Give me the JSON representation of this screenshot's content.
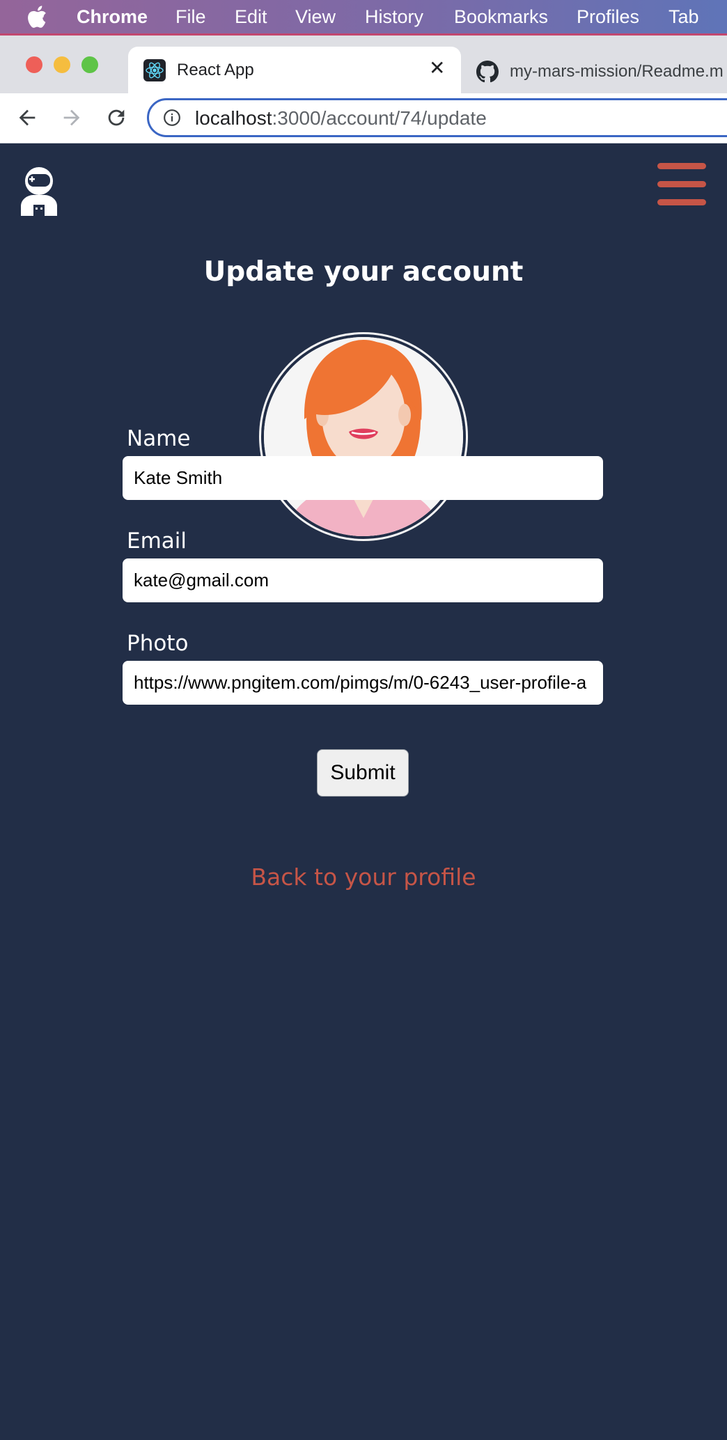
{
  "menubar": {
    "app_name": "Chrome",
    "items": [
      "File",
      "Edit",
      "View",
      "History",
      "Bookmarks",
      "Profiles",
      "Tab"
    ]
  },
  "browser": {
    "tabs": [
      {
        "title": "React App",
        "active": true,
        "icon": "react-icon"
      },
      {
        "title": "my-mars-mission/Readme.m",
        "active": false,
        "icon": "github-icon"
      }
    ],
    "url_host": "localhost",
    "url_path": ":3000/account/74/update"
  },
  "page": {
    "title": "Update your account",
    "fields": {
      "name": {
        "label": "Name",
        "value": "Kate Smith"
      },
      "email": {
        "label": "Email",
        "value": "kate@gmail.com"
      },
      "photo": {
        "label": "Photo",
        "value": "https://www.pngitem.com/pimgs/m/0-6243_user-profile-a"
      }
    },
    "submit_label": "Submit",
    "back_link": "Back to your profile"
  },
  "colors": {
    "background": "#222e47",
    "accent": "#c65547"
  }
}
